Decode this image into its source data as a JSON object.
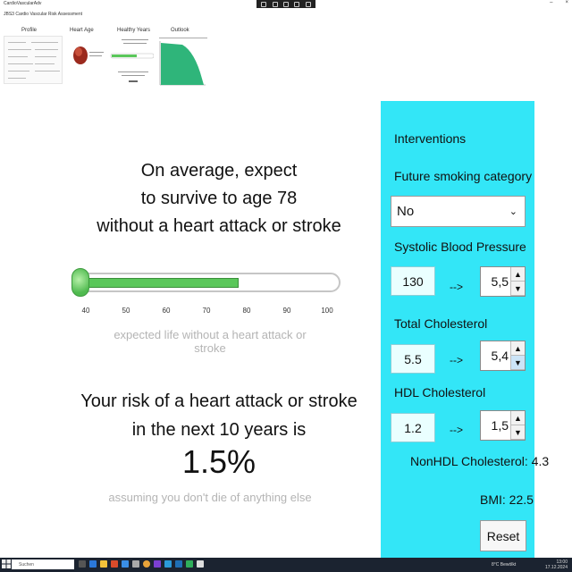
{
  "window": {
    "app_title": "CardioVascularAdv",
    "subtitle": "JBS3 Cardio Vascular Risk Assessment",
    "controls": {
      "minimize": "–",
      "close": "×"
    }
  },
  "tabs": [
    {
      "label": "Profile"
    },
    {
      "label": "Heart Age"
    },
    {
      "label": "Healthy Years"
    },
    {
      "label": "Outlook"
    }
  ],
  "main": {
    "survive_line1": "On average, expect",
    "survive_line2": "to survive to age 78",
    "survive_line3": "without a heart attack or stroke",
    "slider": {
      "value": 78,
      "min": 40,
      "max": 100,
      "ticks": [
        "40",
        "50",
        "60",
        "70",
        "80",
        "90",
        "100"
      ],
      "caption": "expected life without a heart attack or stroke",
      "fill_color": "#5ac75a"
    },
    "risk_line1": "Your risk of a heart attack or stroke",
    "risk_line2": "in the next 10 years is",
    "risk_value": "1.5%",
    "risk_caption": "assuming you don't die of anything else"
  },
  "interventions": {
    "title": "Interventions",
    "smoking_label": "Future smoking category",
    "smoking_value": "No",
    "sbp_label": "Systolic Blood Pressure",
    "sbp_current": "130",
    "sbp_target": "5,5",
    "chol_label": "Total Cholesterol",
    "chol_current": "5.5",
    "chol_target": "5,4",
    "hdl_label": "HDL Cholesterol",
    "hdl_current": "1.2",
    "hdl_target": "1,5",
    "arrow": "-->",
    "nonhdl": "NonHDL Cholesterol: 4.3",
    "bmi": "BMI: 22.5",
    "reset_label": "Reset",
    "panel_color": "#33e6f7"
  },
  "taskbar": {
    "search_placeholder": "Suchen",
    "weather": "8°C Bewölkt",
    "time": "13:00",
    "date": "17.12.2024"
  }
}
